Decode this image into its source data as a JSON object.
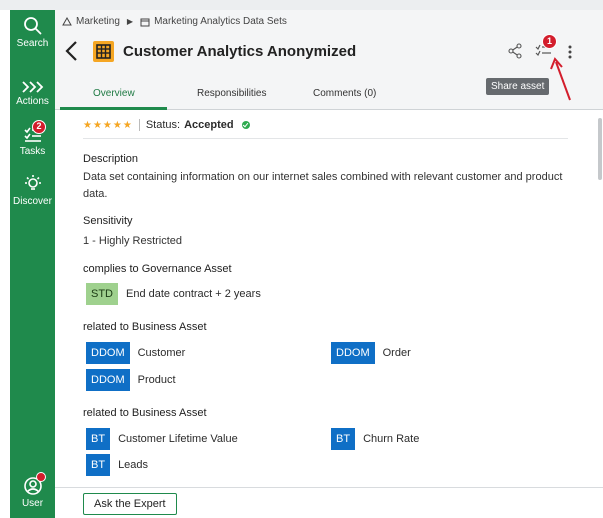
{
  "sidebar": {
    "items": [
      {
        "label": "Search",
        "icon": "search-icon"
      },
      {
        "label": "Actions",
        "icon": "actions-icon"
      },
      {
        "label": "Tasks",
        "icon": "tasks-icon",
        "badge": "2"
      },
      {
        "label": "Discover",
        "icon": "discover-icon"
      },
      {
        "label": "User",
        "icon": "user-icon"
      }
    ]
  },
  "breadcrumb": [
    "Marketing",
    "Marketing Analytics Data Sets"
  ],
  "header": {
    "title": "Customer Analytics Anonymized",
    "tasks_badge": "1",
    "tooltip": "Share asset"
  },
  "tabs": [
    "Overview",
    "Responsibilities",
    "Comments (0)"
  ],
  "status": {
    "stars": "★★★★★",
    "label": "Status:",
    "value": "Accepted"
  },
  "sections": {
    "description_label": "Description",
    "description_text": "Data set containing information on our internet sales combined with relevant customer and product data.",
    "sensitivity_label": "Sensitivity",
    "sensitivity_value": "1 - Highly Restricted",
    "governance_label": "complies to Governance Asset",
    "governance_items": [
      {
        "tag": "STD",
        "name": "End date contract + 2 years"
      }
    ],
    "business_label_1": "related to Business Asset",
    "business_items_1": [
      {
        "tag": "DDOM",
        "name": "Customer"
      },
      {
        "tag": "DDOM",
        "name": "Order"
      },
      {
        "tag": "DDOM",
        "name": "Product"
      }
    ],
    "business_label_2": "related to Business Asset",
    "business_items_2": [
      {
        "tag": "BT",
        "name": "Customer Lifetime Value"
      },
      {
        "tag": "BT",
        "name": "Churn Rate"
      },
      {
        "tag": "BT",
        "name": "Leads"
      }
    ]
  },
  "footer": {
    "button": "Ask the Expert"
  },
  "colors": {
    "brand_green": "#1f8a4c",
    "badge_red": "#d31d2c",
    "tag_blue": "#0f6fc6",
    "std_green": "#9fd18e",
    "asset_orange": "#f5a623"
  }
}
